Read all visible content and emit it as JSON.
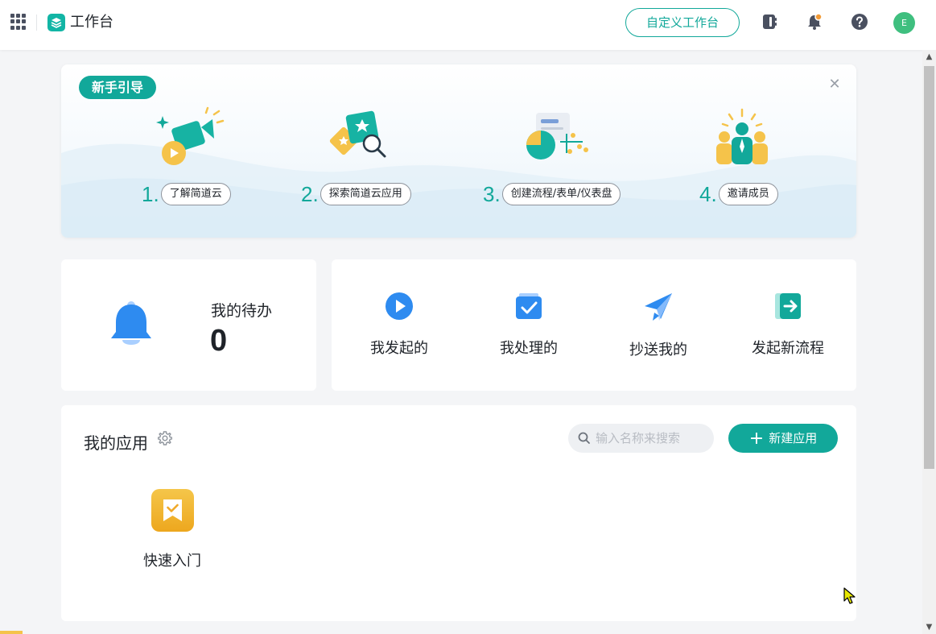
{
  "header": {
    "app_title": "工作台",
    "customize_label": "自定义工作台",
    "avatar_initial": "E",
    "icons": [
      "apps-grid-icon",
      "workspace-logo-icon",
      "address-book-icon",
      "bell-icon",
      "help-icon"
    ],
    "colors": {
      "accent": "#12a89a",
      "avatar": "#3fbf7f",
      "notification_dot": "#f29b38"
    }
  },
  "guide": {
    "badge": "新手引导",
    "close_icon": "close-icon",
    "steps": [
      {
        "num": "1.",
        "label": "了解简道云"
      },
      {
        "num": "2.",
        "label": "探索简道云应用"
      },
      {
        "num": "3.",
        "label": "创建流程/表单/仪表盘"
      },
      {
        "num": "4.",
        "label": "邀请成员"
      }
    ]
  },
  "todo": {
    "label": "我的待办",
    "count": "0",
    "icon": "bell-icon"
  },
  "actions": [
    {
      "label": "我发起的",
      "icon": "play-circle-icon"
    },
    {
      "label": "我处理的",
      "icon": "check-box-icon"
    },
    {
      "label": "抄送我的",
      "icon": "paper-plane-icon"
    },
    {
      "label": "发起新流程",
      "icon": "enter-flow-icon"
    }
  ],
  "apps": {
    "title": "我的应用",
    "search_placeholder": "输入名称来搜索",
    "new_app_label": "新建应用",
    "items": [
      {
        "label": "快速入门",
        "icon": "bookmark-check-icon"
      }
    ]
  }
}
